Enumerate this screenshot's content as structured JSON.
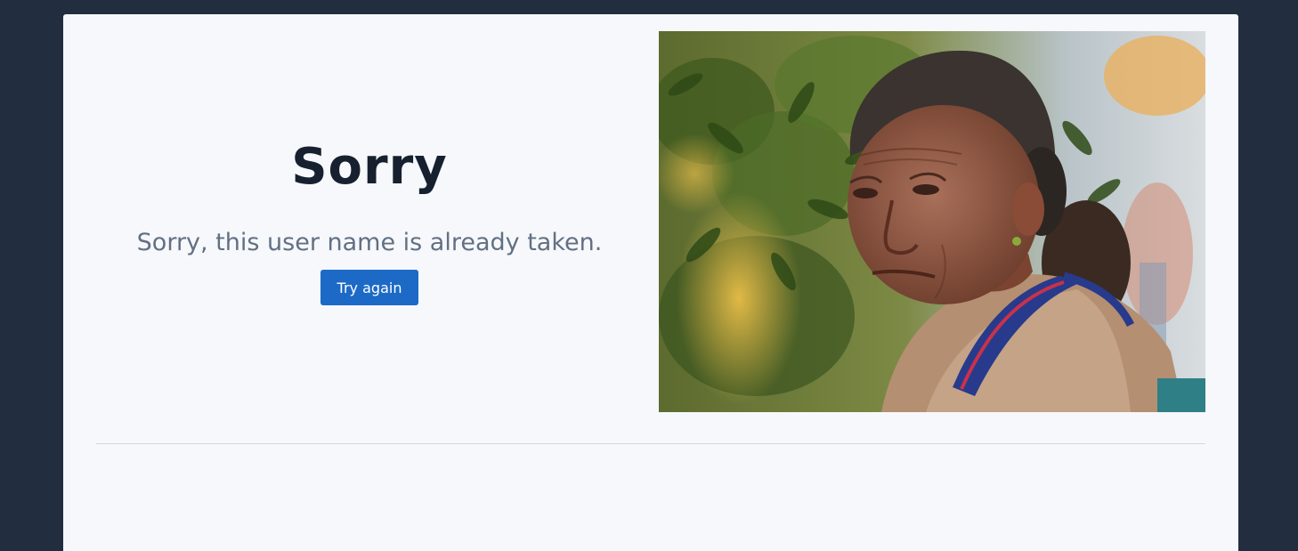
{
  "error": {
    "title": "Sorry",
    "message": "Sorry, this user name is already taken.",
    "retry_label": "Try again"
  },
  "colors": {
    "background": "#222d3f",
    "card": "#f6f8fb",
    "title": "#17202f",
    "message": "#627083",
    "button": "#1c6ac6"
  }
}
